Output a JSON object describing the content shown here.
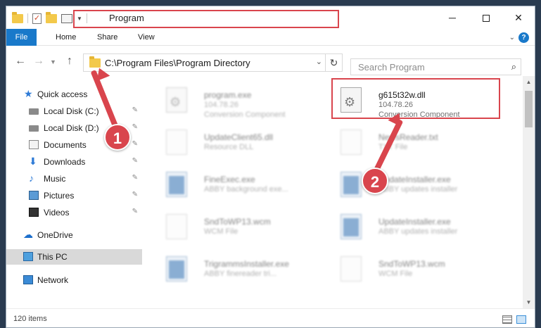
{
  "window": {
    "title": "Program"
  },
  "ribbon": {
    "file": "File",
    "home": "Home",
    "share": "Share",
    "view": "View",
    "help": "?"
  },
  "address": {
    "path": "C:\\Program Files\\Program Directory"
  },
  "search": {
    "placeholder": "Search Program"
  },
  "sidebar": {
    "items": [
      {
        "label": "Quick access",
        "icon": "star-icon"
      },
      {
        "label": "Local Disk (C:)",
        "icon": "disk-icon",
        "pinned": true
      },
      {
        "label": "Local Disk (D:)",
        "icon": "disk-icon",
        "pinned": true
      },
      {
        "label": "Documents",
        "icon": "documents-icon",
        "pinned": true
      },
      {
        "label": "Downloads",
        "icon": "downloads-icon",
        "pinned": true
      },
      {
        "label": "Music",
        "icon": "music-icon",
        "pinned": true
      },
      {
        "label": "Pictures",
        "icon": "pictures-icon",
        "pinned": true
      },
      {
        "label": "Videos",
        "icon": "videos-icon",
        "pinned": true
      },
      {
        "label": "OneDrive",
        "icon": "onedrive-icon"
      },
      {
        "label": "This PC",
        "icon": "this-pc-icon",
        "selected": true
      },
      {
        "label": "Network",
        "icon": "network-icon"
      }
    ]
  },
  "files": [
    {
      "name": "program.exe",
      "line1": "104.78.26",
      "line2": "Conversion Component"
    },
    {
      "name": "g615t32w.dll",
      "line1": "104.78.26",
      "line2": "Conversion Component"
    },
    {
      "name": "UpdateClient65.dll",
      "line1": "Resource DLL"
    },
    {
      "name": "NewsReader.txt",
      "line1": "TXT File"
    },
    {
      "name": "FineExec.exe",
      "line1": "ABBY background exe..."
    },
    {
      "name": "UpdateInstaller.exe",
      "line1": "ABBY updates installer"
    },
    {
      "name": "SndToWP13.wcm",
      "line1": "WCM File"
    },
    {
      "name": "UpdateInstaller.exe",
      "line1": "ABBY updates installer"
    },
    {
      "name": "TrigrammsInstaller.exe",
      "line1": "ABBY finereader tri..."
    },
    {
      "name": "SndToWP13.wcm",
      "line1": "WCM File"
    }
  ],
  "status": {
    "count": "120 items"
  },
  "annotations": {
    "step1": "1",
    "step2": "2"
  },
  "colors": {
    "accent": "#1979ca",
    "highlight": "#d9454d"
  }
}
